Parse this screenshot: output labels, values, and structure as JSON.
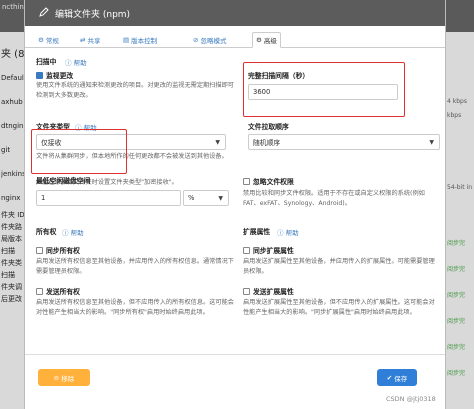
{
  "background": {
    "brand": "ncthin",
    "left_items": [
      "夹 (8",
      "Defaul",
      "axhub",
      "dtngin",
      "git",
      "jenkins",
      "nginx",
      "件夹 ID",
      "件夹路",
      "局版本",
      "扫描",
      "件夹类",
      "扫描",
      "件夹调",
      "后更改"
    ],
    "right_items": [
      "4 kbps",
      "kbps",
      "54-bit in",
      "阅步完",
      "阅步完",
      "阅步完",
      "阅步完",
      "阅步完",
      "阅步完"
    ]
  },
  "modal": {
    "title": "编辑文件夹 (npm)",
    "tabs": [
      "常规",
      "共享",
      "版本控制",
      "忽略模式",
      "高级"
    ],
    "scan": {
      "label": "扫描中",
      "help": "帮助",
      "checkbox_label": "监视更改",
      "desc": "使用文件系统的通知来检测更改的项目。对更改的监视无需定期扫描即可检测到大多数更改。"
    },
    "full_scan": {
      "label": "完整扫描间隔（秒）",
      "value": "3600"
    },
    "folder_type": {
      "label": "文件夹类型",
      "help": "帮助",
      "value": "仅接收",
      "desc": "文件将从集群同步，但本地所作的任何更改都不会被发送到其他设备。",
      "note": "只能在添加新文件夹时设置文件夹类型\"加密接收\"。"
    },
    "pull_order": {
      "label": "文件拉取顺序",
      "value": "随机顺序"
    },
    "min_disk": {
      "label": "最低空闲磁盘空间",
      "value": "1",
      "unit": "%"
    },
    "ignore_perms": {
      "label": "忽略文件权限",
      "desc": "禁用比较和同步文件权限。适用于不存在或自定义权限的系统(例如FAT、exFAT、Synology、Android)。"
    },
    "ownership": {
      "label": "所有权",
      "help": "帮助",
      "sync_label": "同步所有权",
      "sync_desc": "启用发送所有权信息至其他设备，并应用传入的所有权信息。通常情况下需要管理员权限。",
      "send_label": "发送所有权",
      "send_desc": "启用发送所有权信息至其他设备，但不应用传入的所有权信息。这可能会对性能产生相当大的影响。\"同步所有权\"启用时始终启用此项。"
    },
    "xattr": {
      "label": "扩展属性",
      "help": "帮助",
      "sync_label": "同步扩展属性",
      "sync_desc": "启用发送扩展属性至其他设备，并应用传入的扩展属性。可能需要管理员权限。",
      "send_label": "发送扩展属性",
      "send_desc": "启用发送扩展属性至其他设备，但不应用传入的扩展属性。这可能会对性能产生相当大的影响。\"同步扩展属性\"启用时始终启用此项。"
    },
    "footer": {
      "remove": "移除",
      "save": "保存"
    }
  },
  "watermark": "CSDN @jtj0318"
}
